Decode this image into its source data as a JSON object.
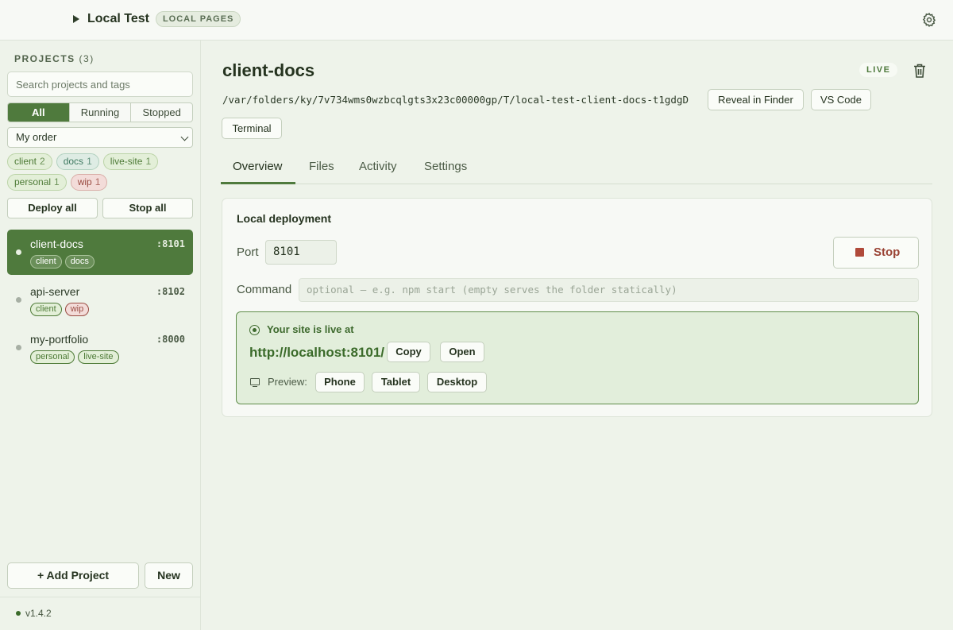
{
  "app": {
    "title": "Local Test",
    "badge": "LOCAL PAGES",
    "version": "v1.4.2"
  },
  "colors": {
    "accent": "#4f7a3d",
    "live_border": "#5f8d4a",
    "stop": "#b04a3a"
  },
  "sidebar": {
    "heading": "PROJECTS",
    "count": "(3)",
    "search_placeholder": "Search projects and tags",
    "filters": [
      "All",
      "Running",
      "Stopped"
    ],
    "active_filter": "All",
    "sort": "My order",
    "tags": [
      {
        "name": "client",
        "count": "2",
        "color": "green"
      },
      {
        "name": "docs",
        "count": "1",
        "color": "blue"
      },
      {
        "name": "live-site",
        "count": "1",
        "color": "green"
      },
      {
        "name": "personal",
        "count": "1",
        "color": "green"
      },
      {
        "name": "wip",
        "count": "1",
        "color": "red"
      }
    ],
    "deploy_all": "Deploy all",
    "stop_all": "Stop all",
    "projects": [
      {
        "name": "client-docs",
        "port": ":8101",
        "tags": [
          "client",
          "docs"
        ],
        "active": true
      },
      {
        "name": "api-server",
        "port": ":8102",
        "tags": [
          "client",
          "wip"
        ],
        "active": false
      },
      {
        "name": "my-portfolio",
        "port": ":8000",
        "tags": [
          "personal",
          "live-site"
        ],
        "active": false
      }
    ],
    "add_project": "+ Add Project",
    "new": "New"
  },
  "main": {
    "title": "client-docs",
    "status": "LIVE",
    "path": "/var/folders/ky/7v734wms0wzbcqlgts3x23c00000gp/T/local-test-client-docs-t1gdgD",
    "reveal": "Reveal in Finder",
    "vscode": "VS Code",
    "terminal": "Terminal",
    "tabs": [
      "Overview",
      "Files",
      "Activity",
      "Settings"
    ],
    "active_tab": "Overview",
    "card": {
      "title": "Local deployment",
      "port_label": "Port",
      "port_value": "8101",
      "stop": "Stop",
      "command_label": "Command",
      "command_placeholder": "optional — e.g. npm start (empty serves the folder statically)",
      "live_heading": "Your site is live at",
      "url": "http://localhost:8101/",
      "copy": "Copy",
      "open": "Open",
      "preview_label": "Preview:",
      "preview_options": [
        "Phone",
        "Tablet",
        "Desktop"
      ]
    }
  }
}
